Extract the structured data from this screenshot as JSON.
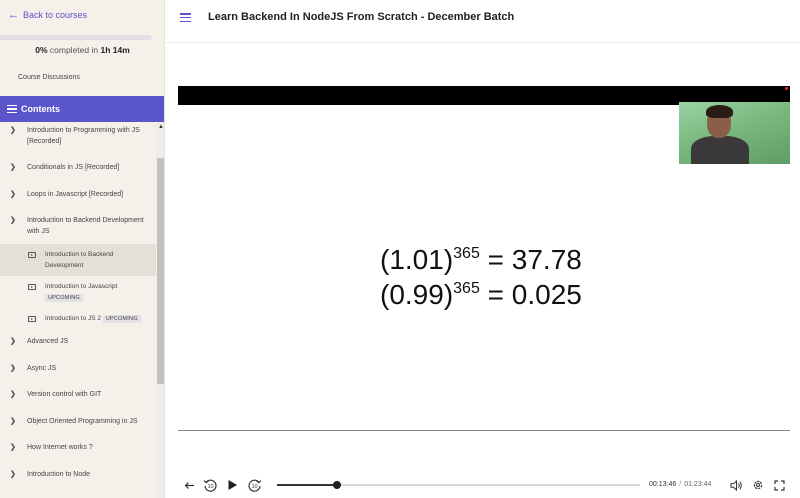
{
  "sidebar": {
    "back_label": "Back to courses",
    "progress": {
      "percent_text": "0%",
      "mid_text": "completed in",
      "duration_text": "1h 14m",
      "fraction": 0.0
    },
    "discussions_label": "Course Discussions",
    "contents_label": "Contents",
    "items": [
      {
        "type": "chapter",
        "title": "Introduction to Programming with JS [Recorded]"
      },
      {
        "type": "chapter",
        "title": "Conditionals in JS [Recorded]"
      },
      {
        "type": "chapter",
        "title": "Loops in Javascript [Recorded]"
      },
      {
        "type": "chapter",
        "title": "Introduction to Backend Development with JS"
      },
      {
        "type": "lesson",
        "title": "Introduction to Backend Development",
        "active": true
      },
      {
        "type": "lesson",
        "title": "Introduction to Javascript",
        "badge": "UPCOMING"
      },
      {
        "type": "lesson",
        "title": "Introduction to JS 2",
        "badge": "UPCOMING"
      },
      {
        "type": "chapter",
        "title": "Advanced JS"
      },
      {
        "type": "chapter",
        "title": "Async JS"
      },
      {
        "type": "chapter",
        "title": "Version control with GIT"
      },
      {
        "type": "chapter",
        "title": "Object Oriented Programming in JS"
      },
      {
        "type": "chapter",
        "title": "How Internet works ?"
      },
      {
        "type": "chapter",
        "title": "Introduction to Node"
      }
    ]
  },
  "header": {
    "title": "Learn Backend In NodeJS From Scratch - December Batch"
  },
  "video": {
    "slide": {
      "line1": {
        "base": "(1.01)",
        "exp": "365",
        "rhs": "= 37.78"
      },
      "line2": {
        "base": "(0.99)",
        "exp": "365",
        "rhs": "= 0.025"
      }
    },
    "controls": {
      "current_time": "00:13:46",
      "separator": "/",
      "duration": "01:23:44",
      "progress_fraction": 0.165,
      "rewind_label": "10",
      "forward_label": "10"
    }
  },
  "colors": {
    "accent": "#5b55cc",
    "sidebar_bg": "#f5f1ea",
    "active_lesson_bg": "#e4e0d8"
  },
  "icons": [
    "arrow-left-icon",
    "menu-icon",
    "chevron-right-icon",
    "video-lesson-icon",
    "back-icon",
    "rewind-10-icon",
    "play-icon",
    "forward-10-icon",
    "volume-icon",
    "settings-icon",
    "fullscreen-icon",
    "scroll-up-icon"
  ]
}
